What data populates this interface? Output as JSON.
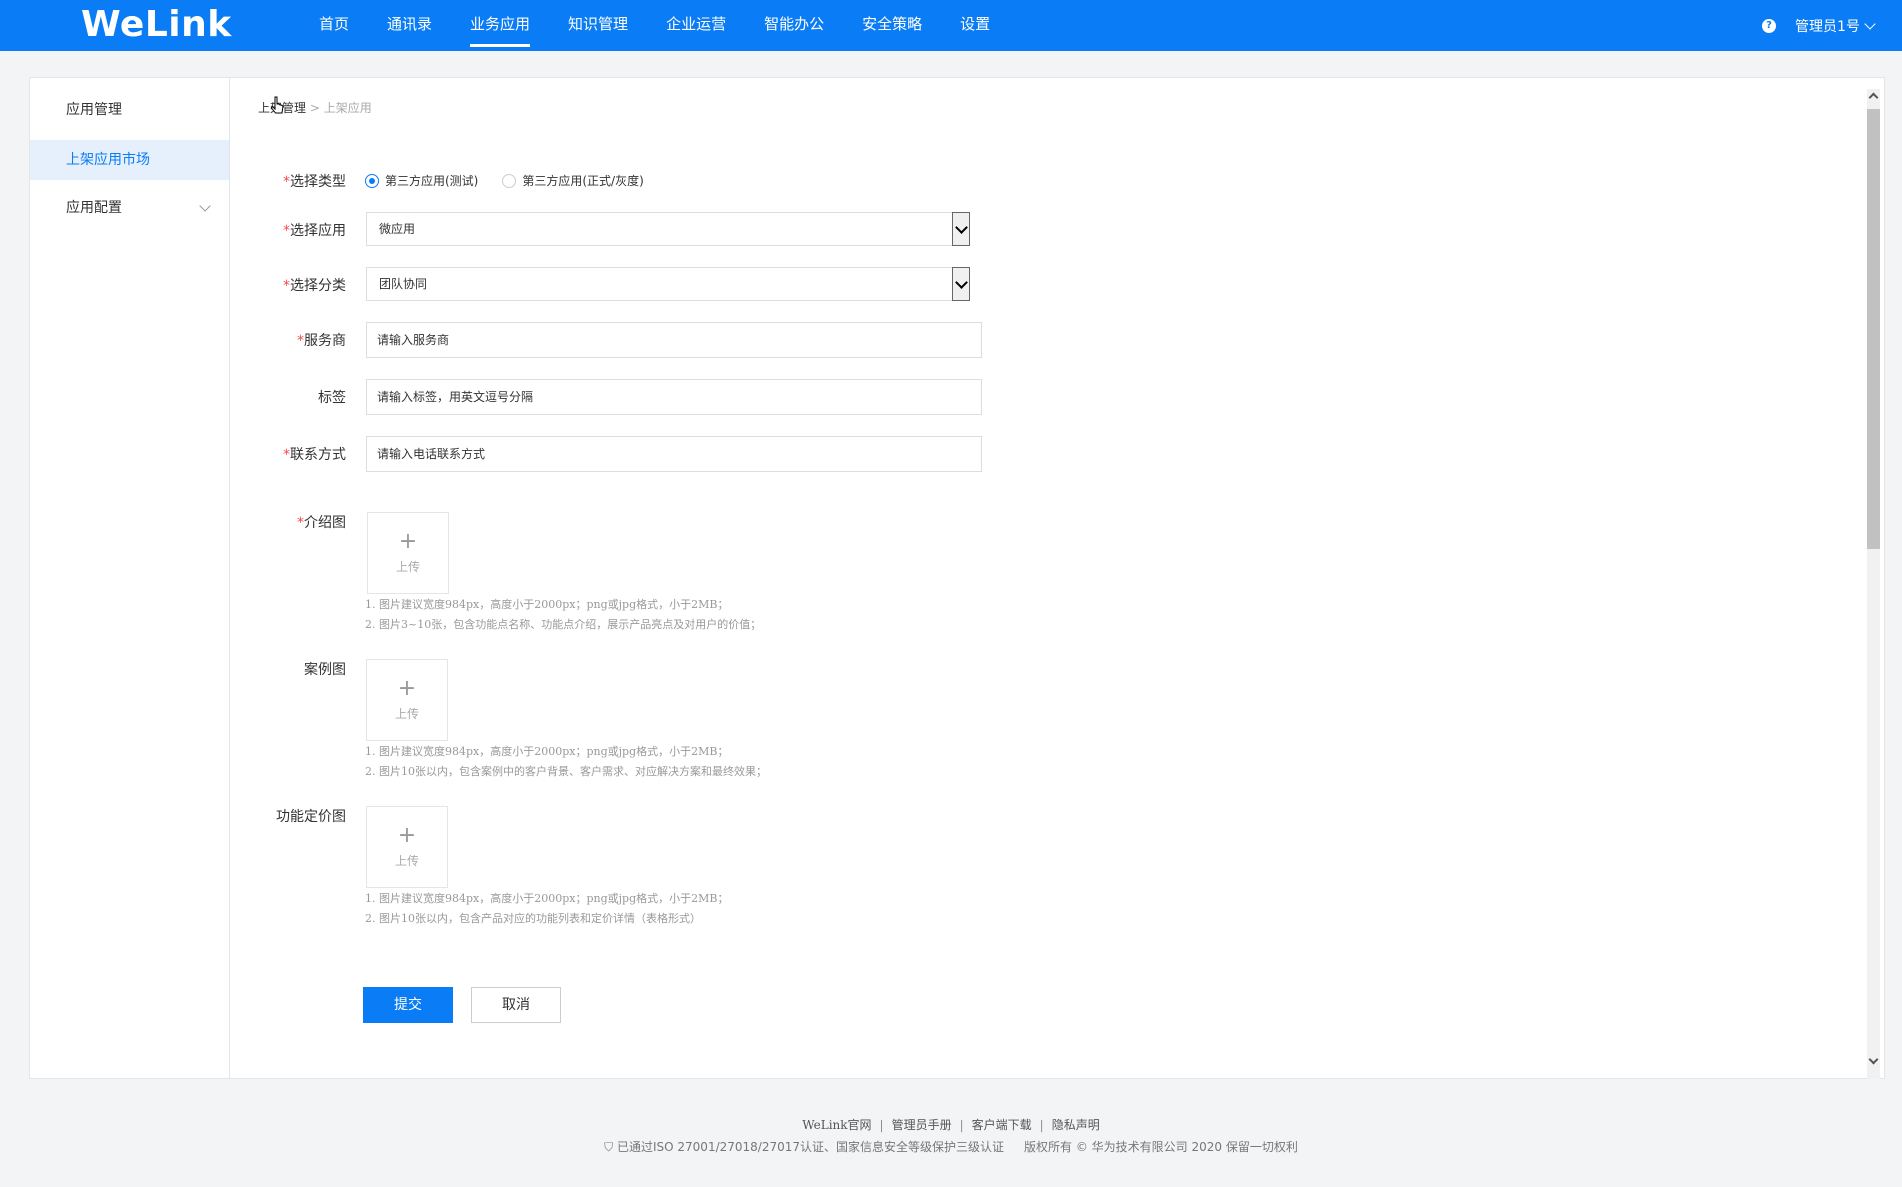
{
  "brand": {
    "logo": "WeLink",
    "primary_color": "#0a7cf5"
  },
  "topnav": {
    "items": [
      "首页",
      "通讯录",
      "业务应用",
      "知识管理",
      "企业运营",
      "智能办公",
      "安全策略",
      "设置"
    ],
    "active": "业务应用",
    "help": "?",
    "admin": "管理员1号"
  },
  "sidebar": {
    "items": [
      "应用管理",
      "上架应用市场",
      "应用配置"
    ],
    "active": "上架应用市场"
  },
  "breadcrumb": {
    "parent": "上架管理",
    "sep": " > ",
    "current": "上架应用"
  },
  "form": {
    "type_label": "选择类型",
    "type_options": [
      "第三方应用(测试)",
      "第三方应用(正式/灰度)"
    ],
    "type_selected": "第三方应用(测试)",
    "app_label": "选择应用",
    "app_value": "微应用",
    "category_label": "选择分类",
    "category_value": "团队协同",
    "vendor_label": "服务商",
    "vendor_placeholder": "请输入服务商",
    "tags_label": "标签",
    "tags_placeholder": "请输入标签，用英文逗号分隔",
    "contact_label": "联系方式",
    "contact_placeholder": "请输入电话联系方式",
    "intro_label": "介绍图",
    "intro_hints": [
      "1. 图片建议宽度984px，高度小于2000px；png或jpg格式，小于2MB；",
      "2. 图片3~10张，包含功能点名称、功能点介绍，展示产品亮点及对用户的价值；"
    ],
    "case_label": "案例图",
    "case_hints": [
      "1. 图片建议宽度984px，高度小于2000px；png或jpg格式，小于2MB；",
      "2. 图片10张以内，包含案例中的客户背景、客户需求、对应解决方案和最终效果；"
    ],
    "pricing_label": "功能定价图",
    "pricing_hints": [
      "1. 图片建议宽度984px，高度小于2000px；png或jpg格式，小于2MB；",
      "2. 图片10张以内，包含产品对应的功能列表和定价详情（表格形式）"
    ],
    "upload_plus": "+",
    "upload_text": "上传",
    "required_mark": "*",
    "submit": "提交",
    "cancel": "取消"
  },
  "footer": {
    "links": [
      "WeLink官网",
      "管理员手册",
      "客户端下载",
      "隐私声明"
    ],
    "link_sep": "|",
    "cert": "已通过ISO 27001/27018/27017认证、国家信息安全等级保护三级认证",
    "copyright": "版权所有 © 华为技术有限公司 2020 保留一切权利"
  }
}
